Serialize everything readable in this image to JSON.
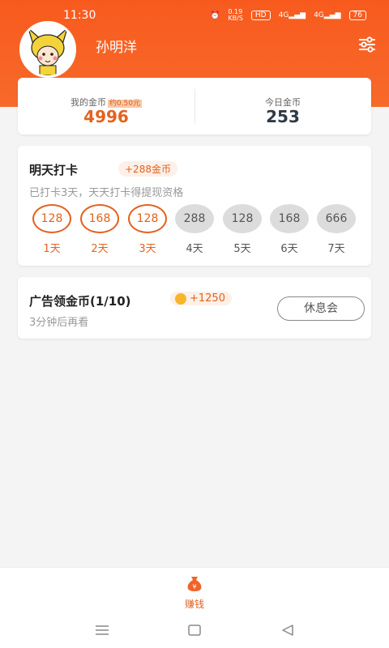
{
  "status": {
    "time": "11:30",
    "speed": "0.19\nKB/S",
    "hd": "HD",
    "signal1": "4G",
    "signal2": "4G",
    "battery": "76"
  },
  "user": {
    "name": "孙明洋"
  },
  "coins": {
    "my_label": "我的金币",
    "my_approx": "约0.50元",
    "my_value": "4996",
    "today_label": "今日金币",
    "today_value": "253"
  },
  "checkin": {
    "title": "明天打卡",
    "bonus": "+288金币",
    "subtitle": "已打卡3天，天天打卡得提现资格",
    "days": [
      {
        "amount": "128",
        "label": "1天",
        "done": true
      },
      {
        "amount": "168",
        "label": "2天",
        "done": true
      },
      {
        "amount": "128",
        "label": "3天",
        "done": true
      },
      {
        "amount": "288",
        "label": "4天",
        "done": false
      },
      {
        "amount": "128",
        "label": "5天",
        "done": false
      },
      {
        "amount": "168",
        "label": "6天",
        "done": false
      },
      {
        "amount": "666",
        "label": "7天",
        "done": false
      }
    ]
  },
  "ad": {
    "title": "广告领金币(1/10)",
    "bonus": "+1250",
    "subtitle": "3分钟后再看",
    "button": "休息会"
  },
  "tabbar": {
    "earn_label": "赚钱"
  },
  "colors": {
    "accent": "#e4621e",
    "header": "#f85a1e"
  }
}
